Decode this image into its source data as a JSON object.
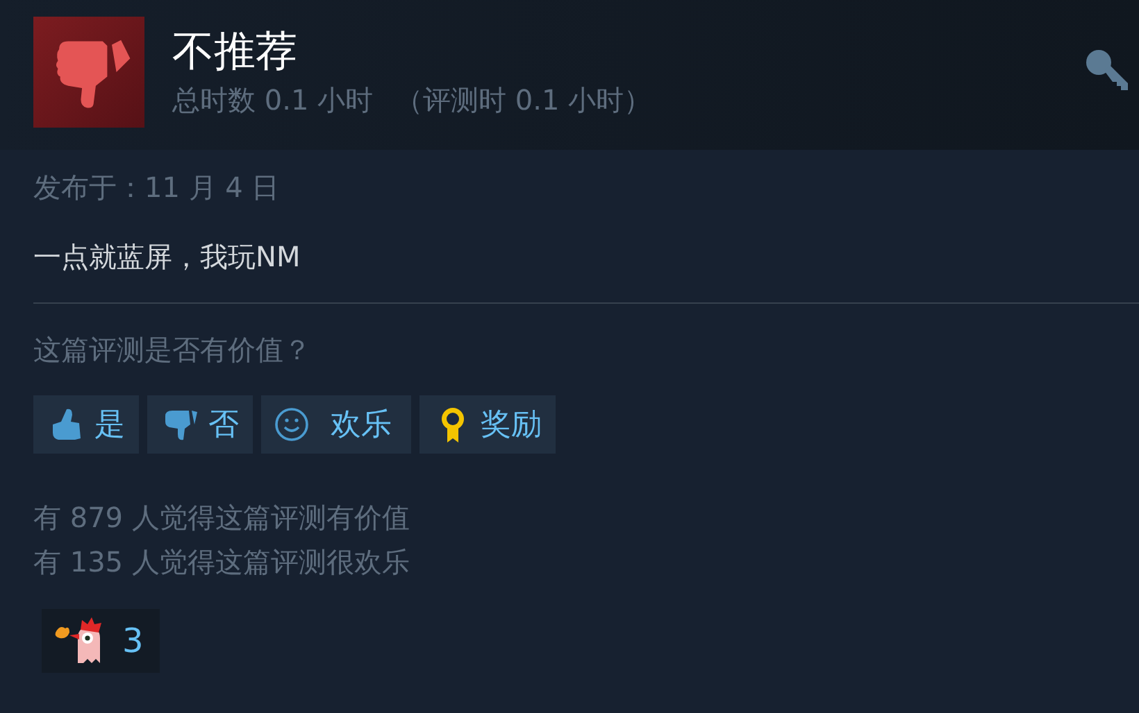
{
  "review": {
    "recommended": false,
    "verdict": "不推荐",
    "hours": "总时数 0.1 小时",
    "hours_at_review": "（评测时 0.1 小时）"
  },
  "posted": "发布于：11 月 4 日",
  "body": "一点就蓝屏，我玩NM",
  "question": "这篇评测是否有价值？",
  "buttons": [
    {
      "kind": "yes",
      "label": "是"
    },
    {
      "kind": "no",
      "label": "否"
    },
    {
      "kind": "funny",
      "label": "欢乐"
    },
    {
      "kind": "award",
      "label": "奖励"
    }
  ],
  "stats": [
    "有 879 人觉得这篇评测有价值",
    "有 135 人觉得这篇评测很欢乐"
  ],
  "awards": [
    {
      "count": "3"
    }
  ]
}
